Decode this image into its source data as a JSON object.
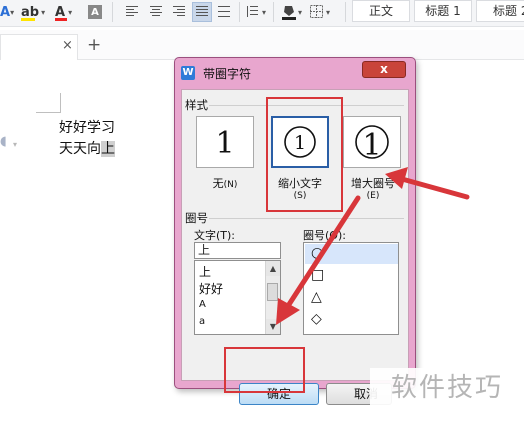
{
  "ribbon": {
    "font_a_glyph": "A",
    "highlight_glyph": "ab",
    "font_color_glyph": "A",
    "char_shade_glyph": "A",
    "dropdown_glyph": "▾",
    "styles": [
      "正文",
      "标题 1",
      "标题 2"
    ],
    "accent": "#2b6fd6",
    "highlight_color": "#ffe400",
    "font_color_bar": "#e22222"
  },
  "tabbar": {
    "close_glyph": "×",
    "add_glyph": "+"
  },
  "document": {
    "line1": "好好学习",
    "line2_prefix": "天天向",
    "line2_selected": "上"
  },
  "dialog": {
    "title": "带圈字符",
    "close_glyph": "x",
    "style_group": "样式",
    "options": [
      {
        "label_main": "无",
        "label_key": "(N)",
        "preview": "1"
      },
      {
        "label_main": "缩小文字",
        "label_key": "(S)",
        "preview": "①"
      },
      {
        "label_main": "增大圈号",
        "label_key": "(E)",
        "preview": "1"
      }
    ],
    "ring_group": "圈号",
    "text_label": "文字(T):",
    "ring_label": "圈号(O):",
    "text_value": "上",
    "text_list": [
      "上",
      "好好",
      "A",
      "a"
    ],
    "ring_list": [
      "○",
      "□",
      "△",
      "◇"
    ],
    "ok": "确定",
    "cancel": "取消",
    "title_bar_color": "#e8a6ce"
  },
  "annotation": {
    "arrow_color": "#d8363a",
    "watermark": "软件技巧"
  }
}
